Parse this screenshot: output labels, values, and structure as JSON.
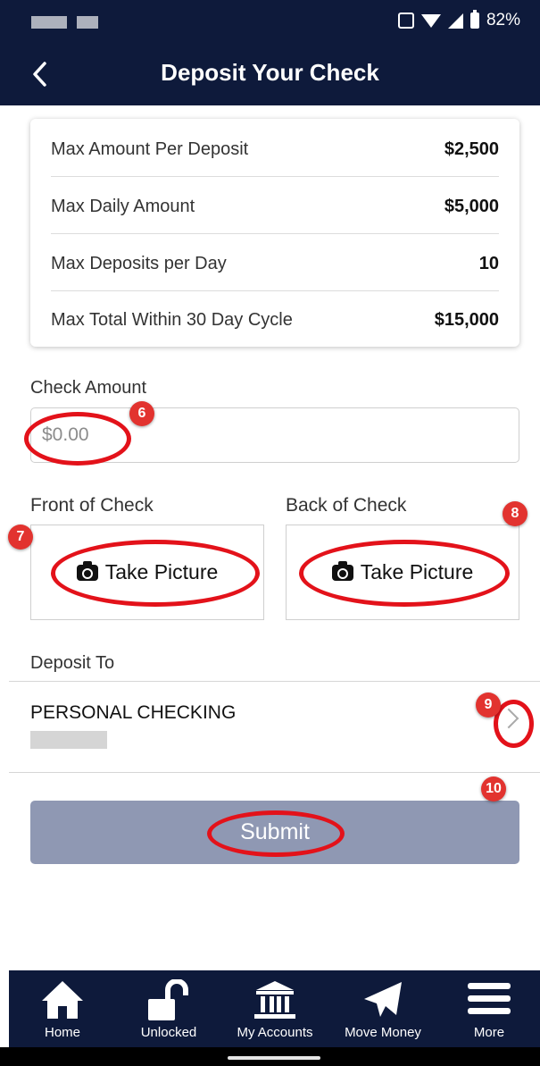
{
  "status_bar": {
    "battery": "82%"
  },
  "header": {
    "title": "Deposit Your Check"
  },
  "limits": [
    {
      "label": "Max Amount Per Deposit",
      "value": "$2,500"
    },
    {
      "label": "Max Daily Amount",
      "value": "$5,000"
    },
    {
      "label": "Max Deposits per Day",
      "value": "10"
    },
    {
      "label": "Max Total Within 30 Day Cycle",
      "value": "$15,000"
    }
  ],
  "check_amount": {
    "label": "Check Amount",
    "placeholder": "$0.00"
  },
  "front": {
    "label": "Front of Check",
    "button": "Take Picture"
  },
  "back": {
    "label": "Back of Check",
    "button": "Take Picture"
  },
  "deposit_to": {
    "label": "Deposit To",
    "account_name": "PERSONAL CHECKING"
  },
  "submit_label": "Submit",
  "annotations": [
    "6",
    "7",
    "8",
    "9",
    "10"
  ],
  "nav": [
    {
      "label": "Home",
      "icon": "home-icon"
    },
    {
      "label": "Unlocked",
      "icon": "unlock-icon"
    },
    {
      "label": "My Accounts",
      "icon": "bank-icon"
    },
    {
      "label": "Move Money",
      "icon": "paper-plane-icon"
    },
    {
      "label": "More",
      "icon": "menu-icon"
    }
  ],
  "colors": {
    "navy": "#0e1a3b",
    "submit": "#8f98b3",
    "annotation_red": "#e3121a"
  }
}
